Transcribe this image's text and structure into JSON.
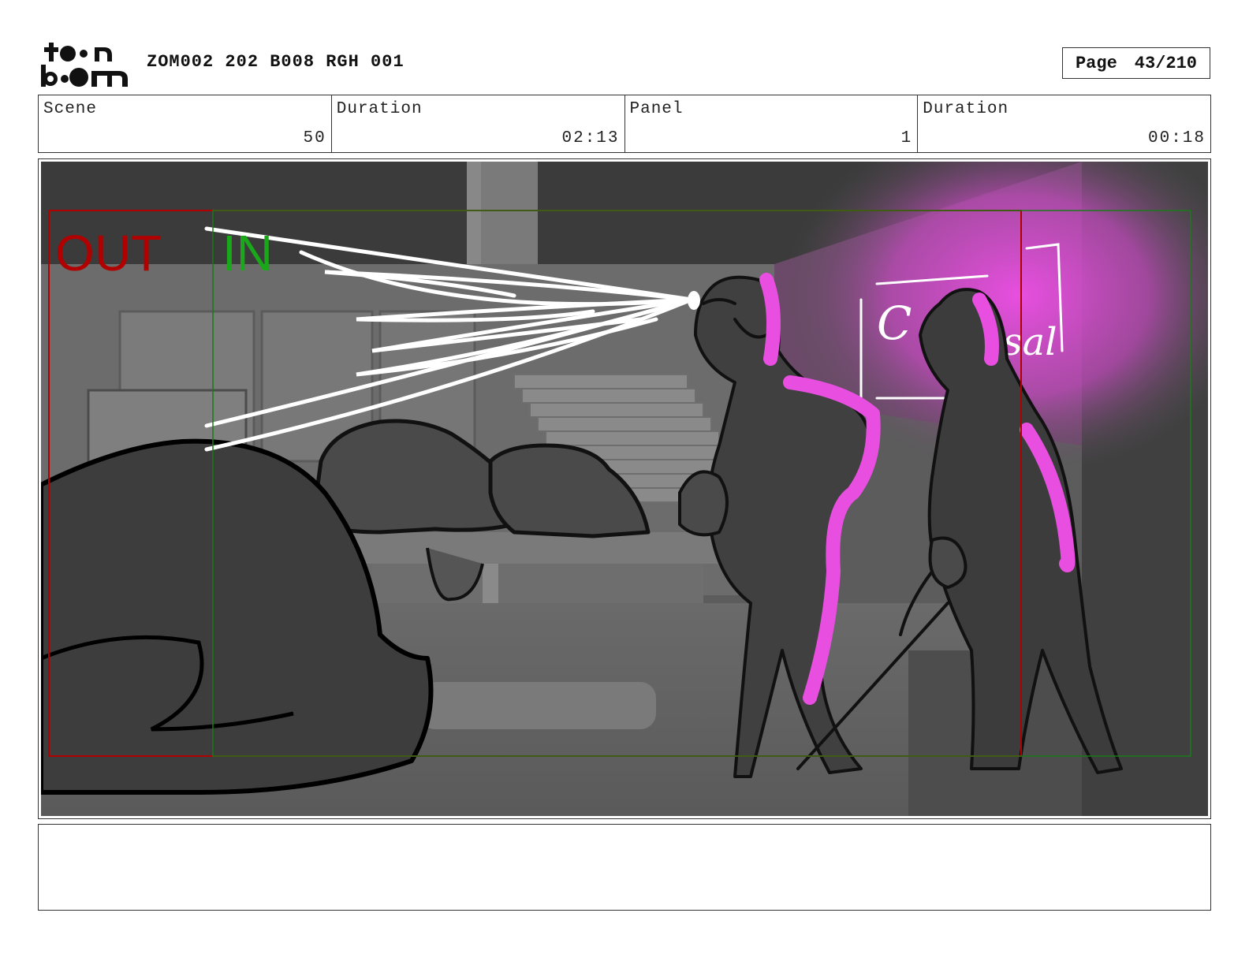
{
  "header": {
    "logo_text": "toon boom",
    "project_id": "ZOM002 202 B008 RGH 001",
    "page_label": "Page",
    "page_number": "43/210"
  },
  "info": {
    "scene_label": "Scene",
    "scene_value": "50",
    "scene_duration_label": "Duration",
    "scene_duration_value": "02:13",
    "panel_label": "Panel",
    "panel_value": "1",
    "panel_duration_label": "Duration",
    "panel_duration_value": "00:18"
  },
  "panel": {
    "out_label": "OUT",
    "in_label": "IN",
    "sign_text_1": "C",
    "sign_text_2": "sal",
    "out_color": "#b00000",
    "in_color": "#1aa81a",
    "highlight_color": "#e84fe0"
  },
  "notes": {
    "text": ""
  }
}
